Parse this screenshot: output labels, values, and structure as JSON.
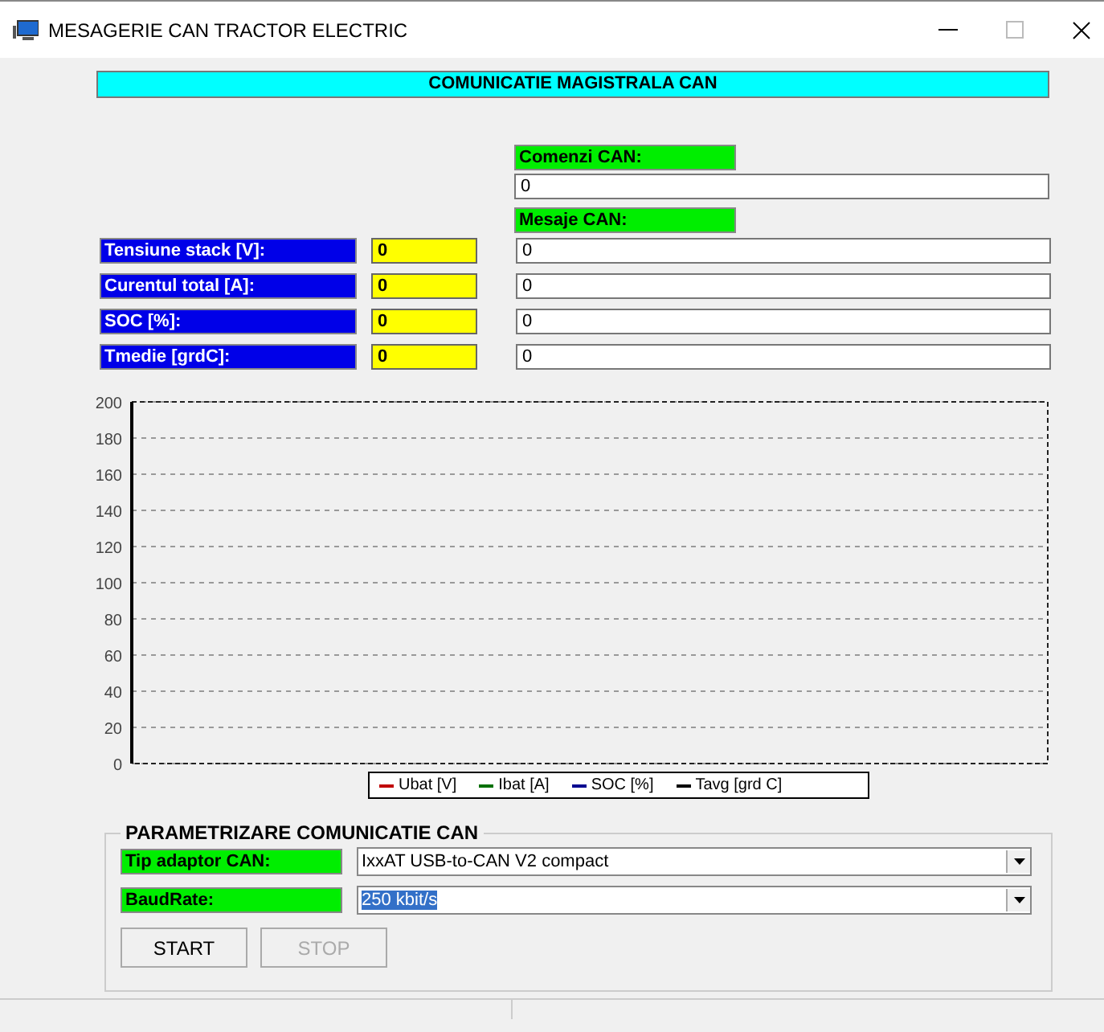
{
  "window": {
    "title": "MESAGERIE CAN TRACTOR ELECTRIC"
  },
  "header": "COMUNICATIE MAGISTRALA CAN",
  "commands": {
    "label": "Comenzi CAN:",
    "value": "0"
  },
  "messages": {
    "label": "Mesaje CAN:"
  },
  "readings": [
    {
      "label": "Tensiune stack [V]:",
      "value": "0",
      "message": "0"
    },
    {
      "label": "Curentul total [A]:",
      "value": "0",
      "message": "0"
    },
    {
      "label": "SOC [%]:",
      "value": "0",
      "message": "0"
    },
    {
      "label": "Tmedie [grdC]:",
      "value": "0",
      "message": "0"
    }
  ],
  "chart": {
    "chart_data": {
      "type": "line",
      "grid": true,
      "ylim": [
        0,
        200
      ],
      "yticks": [
        0,
        20,
        40,
        60,
        80,
        100,
        120,
        140,
        160,
        180,
        200
      ],
      "series": [
        {
          "name": "Ubat [V]",
          "color": "#c00000"
        },
        {
          "name": "Ibat [A]",
          "color": "#007000"
        },
        {
          "name": "SOC [%]",
          "color": "#000090"
        },
        {
          "name": "Tavg [grd C]",
          "color": "#000000"
        }
      ]
    }
  },
  "settings": {
    "title": "PARAMETRIZARE COMUNICATIE CAN",
    "fields": [
      {
        "label": "Tip adaptor CAN:",
        "value": "IxxAT USB-to-CAN V2 compact",
        "selected": false
      },
      {
        "label": "BaudRate:",
        "value": "250 kbit/s",
        "selected": true
      }
    ],
    "buttons": [
      {
        "label": "START",
        "disabled": false
      },
      {
        "label": "STOP",
        "disabled": true
      }
    ]
  }
}
